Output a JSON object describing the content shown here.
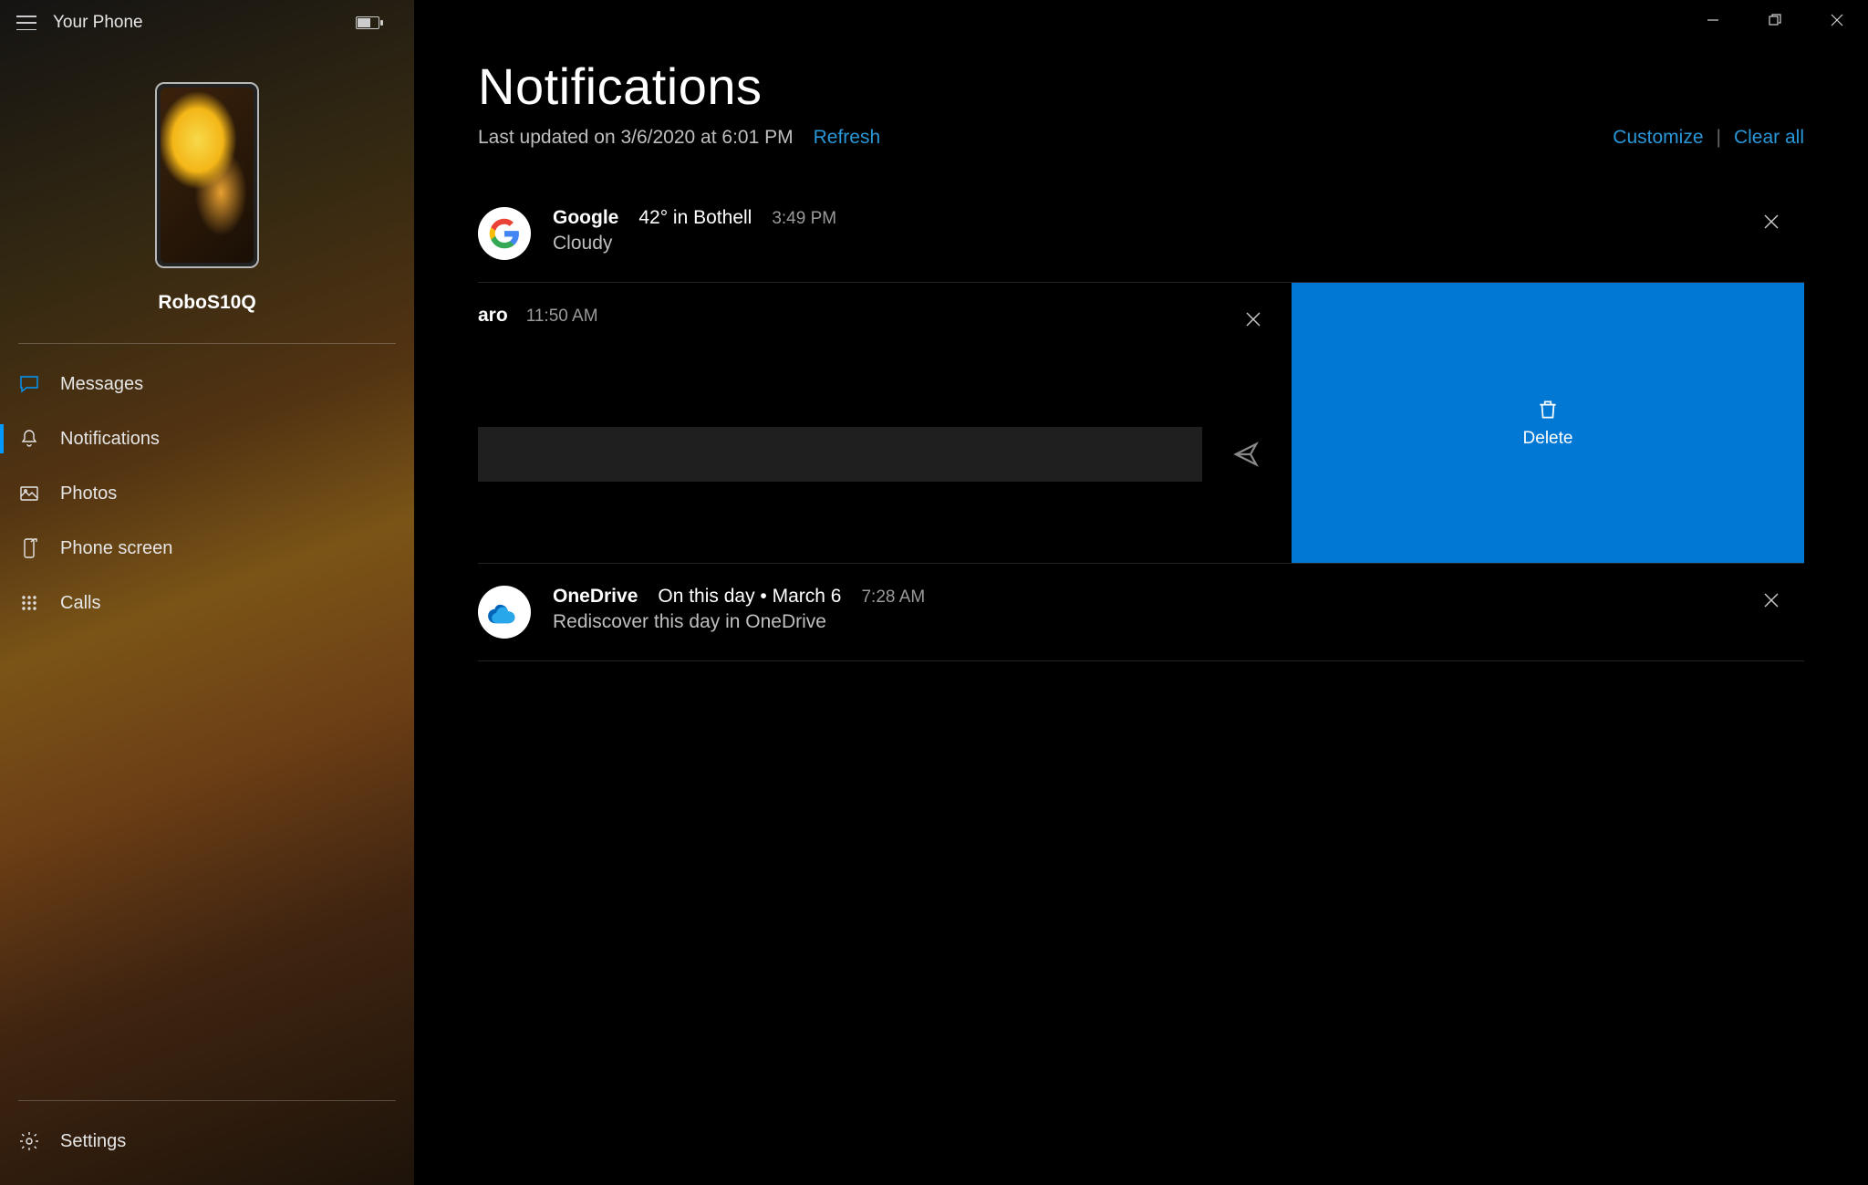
{
  "app": {
    "title": "Your Phone"
  },
  "phone": {
    "name": "RoboS10Q"
  },
  "sidebar": {
    "items": [
      {
        "label": "Messages"
      },
      {
        "label": "Notifications"
      },
      {
        "label": "Photos"
      },
      {
        "label": "Phone screen"
      },
      {
        "label": "Calls"
      }
    ],
    "settings": "Settings"
  },
  "main": {
    "heading": "Notifications",
    "last_updated": "Last updated on 3/6/2020 at 6:01 PM",
    "refresh": "Refresh",
    "customize": "Customize",
    "clear_all": "Clear all"
  },
  "notifications": [
    {
      "app": "Google",
      "title": "42° in Bothell",
      "time": "3:49 PM",
      "subtitle": "Cloudy"
    },
    {
      "app": "aro",
      "title": "",
      "time": "11:50 AM",
      "subtitle": "",
      "reply_placeholder": "",
      "delete_label": "Delete"
    },
    {
      "app": "OneDrive",
      "title": "On this day • March 6",
      "time": "7:28 AM",
      "subtitle": "Rediscover this day in OneDrive"
    }
  ]
}
